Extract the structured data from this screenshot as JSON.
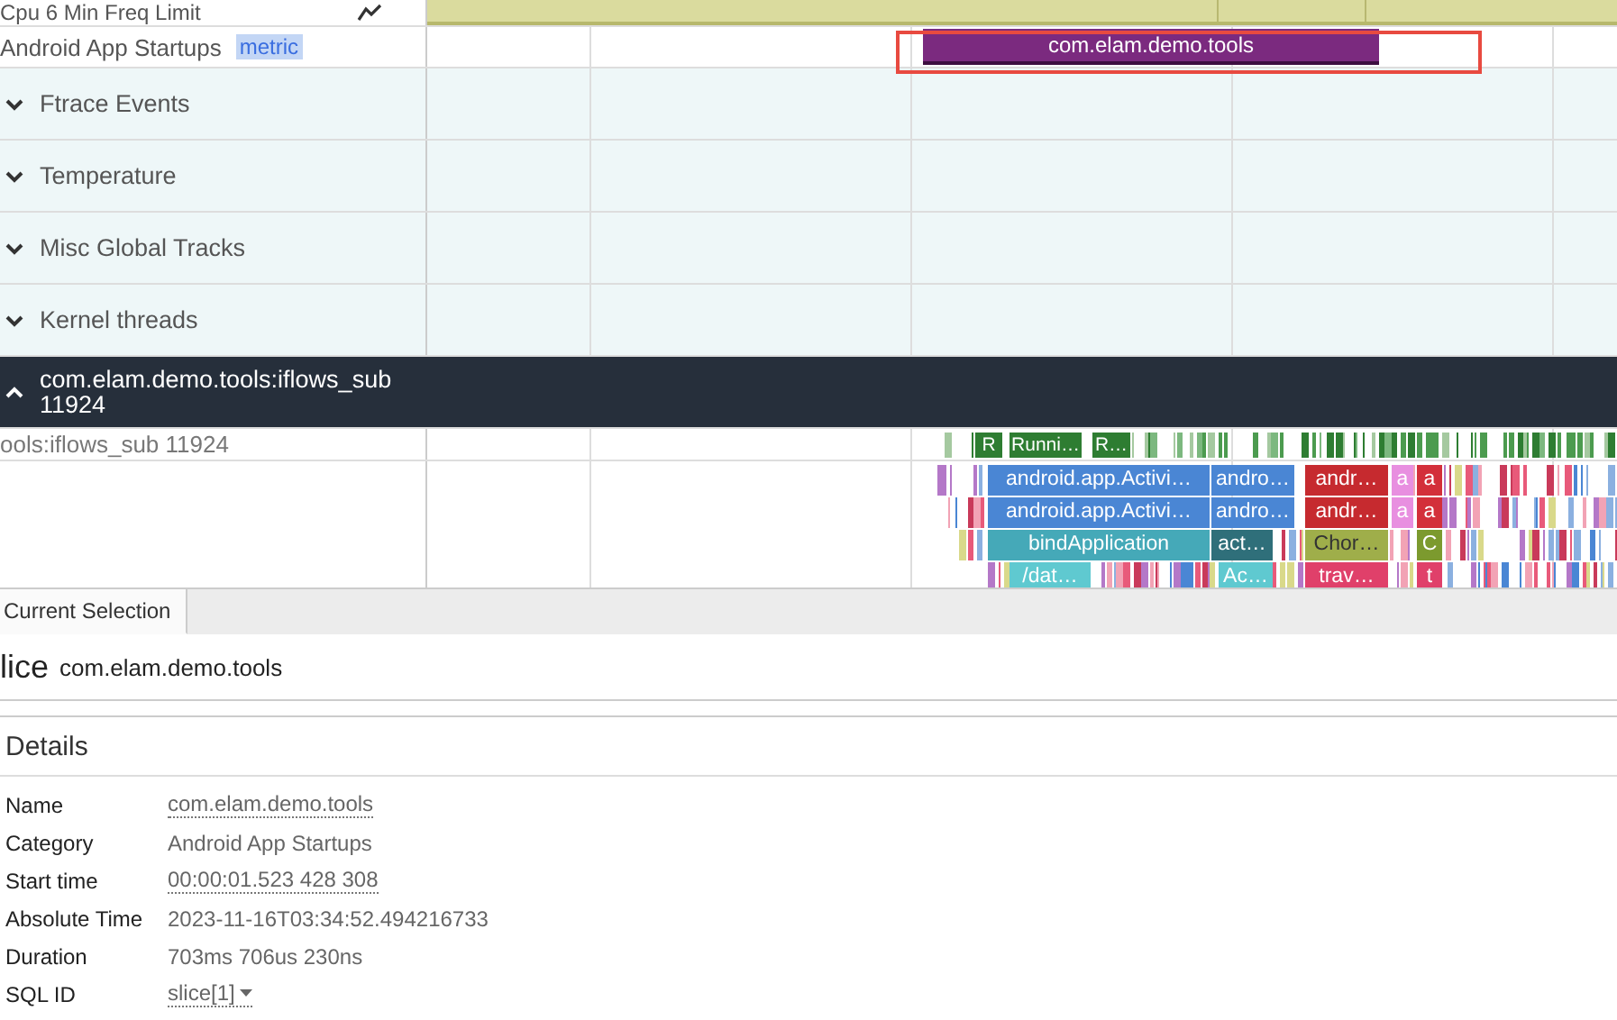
{
  "tracks": [
    {
      "kind": "counter",
      "title": "Cpu 6 Min Freq Limit"
    },
    {
      "kind": "startup",
      "title": "Android App Startups",
      "tag": "metric",
      "slices": [
        {
          "text": "com.elam.demo.tools",
          "color": "#7b2a7f"
        }
      ]
    },
    {
      "kind": "group",
      "title": "Ftrace Events",
      "expanded": false
    },
    {
      "kind": "group",
      "title": "Temperature",
      "expanded": false
    },
    {
      "kind": "group",
      "title": "Misc Global Tracks",
      "expanded": false
    },
    {
      "kind": "group",
      "title": "Kernel threads",
      "expanded": false
    },
    {
      "kind": "group",
      "title": "com.elam.demo.tools:iflows_sub 11924",
      "expanded": true
    },
    {
      "kind": "thread_state",
      "title": "ools:iflows_sub 11924",
      "slices": [
        {
          "text": "R",
          "color": "#2e7d32"
        },
        {
          "text": "Runni…",
          "color": "#2e7d32"
        },
        {
          "text": "R…",
          "color": "#2e7d32"
        }
      ]
    },
    {
      "kind": "slices",
      "levels": [
        [
          {
            "text": "android.app.Activi…",
            "color": "#4a86d4"
          },
          {
            "text": "andro…",
            "color": "#4a86d4"
          },
          {
            "text": "andr…",
            "color": "#c62a2f"
          },
          {
            "text": "a",
            "color": "#e88fe0"
          },
          {
            "text": "a",
            "color": "#d32f3a"
          }
        ],
        [
          {
            "text": "android.app.Activi…",
            "color": "#4a86d4"
          },
          {
            "text": "andro…",
            "color": "#4a86d4"
          },
          {
            "text": "andr…",
            "color": "#c62a2f"
          },
          {
            "text": "a",
            "color": "#e88fe0"
          },
          {
            "text": "a",
            "color": "#d32f3a"
          }
        ],
        [
          {
            "text": "bindApplication",
            "color": "#45a9b8"
          },
          {
            "text": "act…",
            "color": "#2f6f7a"
          },
          {
            "text": "Chor…",
            "color": "#9fae4a"
          },
          {
            "text": "C",
            "color": "#7c9a2e"
          }
        ],
        [
          {
            "text": "/dat…",
            "color": "#5fc9d0"
          },
          {
            "text": "Ac…",
            "color": "#5fc9d0"
          },
          {
            "text": "trav…",
            "color": "#e0406a"
          },
          {
            "text": "t",
            "color": "#e0406a"
          }
        ]
      ]
    }
  ],
  "panel": {
    "tabs": [
      {
        "label": "Current Selection",
        "selected": true
      }
    ],
    "heading": {
      "kind": "lice",
      "name": "com.elam.demo.tools"
    },
    "section": "Details",
    "details": [
      {
        "label": "Name",
        "value": "com.elam.demo.tools",
        "kind": "link"
      },
      {
        "label": "Category",
        "value": "Android App Startups",
        "kind": "text"
      },
      {
        "label": "Start time",
        "value": "00:00:01.523 428 308",
        "kind": "link"
      },
      {
        "label": "Absolute Time",
        "value": "2023-11-16T03:34:52.494216733",
        "kind": "text"
      },
      {
        "label": "Duration",
        "value": "703ms 706us 230ns",
        "kind": "text"
      },
      {
        "label": "SQL ID",
        "value": "slice[1]",
        "kind": "menu"
      }
    ]
  }
}
